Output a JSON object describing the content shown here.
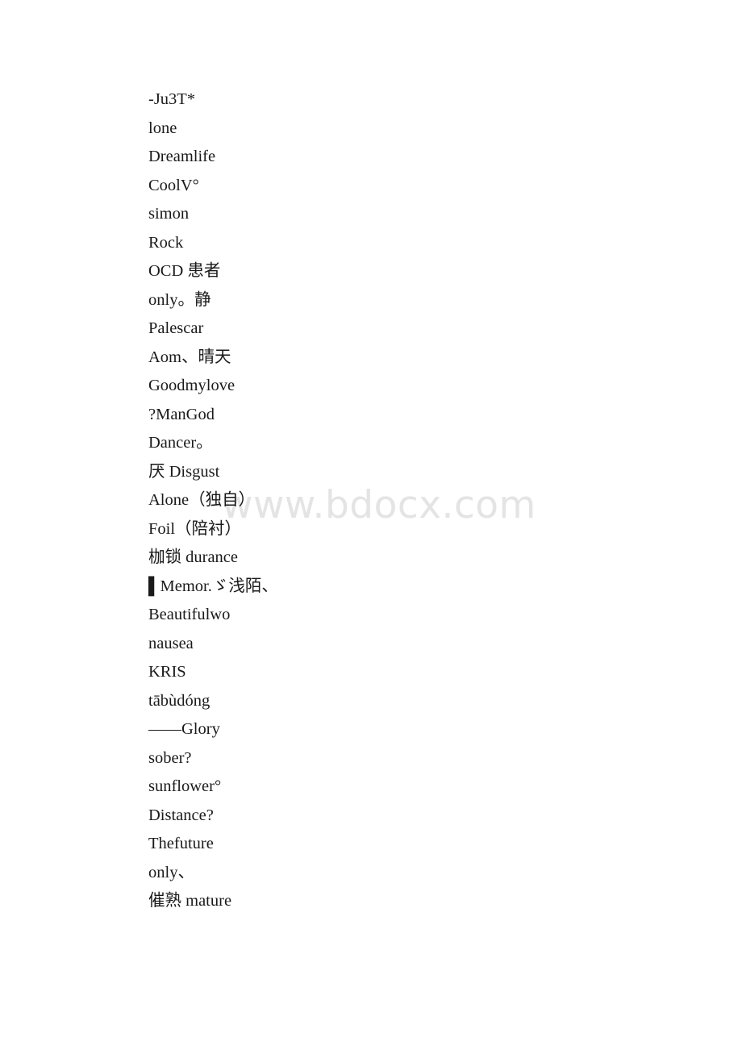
{
  "document": {
    "watermark": "www.bdocx.com",
    "lines": [
      {
        "text": "-Ju3T*"
      },
      {
        "text": "lone"
      },
      {
        "text": "Dreamlife"
      },
      {
        "text": "CoolV°"
      },
      {
        "text": "simon"
      },
      {
        "text": "Rock"
      },
      {
        "text": "OCD 患者"
      },
      {
        "text": "only。静"
      },
      {
        "text": "Palescar"
      },
      {
        "text": "Aom、晴天"
      },
      {
        "text": "Goodmylove"
      },
      {
        "text": "?ManGod"
      },
      {
        "text": "Dancer。"
      },
      {
        "text": "厌 Disgust"
      },
      {
        "text": "Alone（独自）"
      },
      {
        "text": "Foil（陪衬）"
      },
      {
        "text": "枷锁 durance"
      },
      {
        "text": "▌Memor.ゞ浅陌、"
      },
      {
        "text": "Beautifulwo"
      },
      {
        "text": "nausea"
      },
      {
        "text": "KRIS"
      },
      {
        "text": "tābùdóng"
      },
      {
        "text": "——Glory"
      },
      {
        "text": "sober?"
      },
      {
        "text": "sunflower°"
      },
      {
        "text": "Distance?"
      },
      {
        "text": "Thefuture"
      },
      {
        "text": "only、"
      },
      {
        "text": "催熟 mature"
      }
    ]
  }
}
